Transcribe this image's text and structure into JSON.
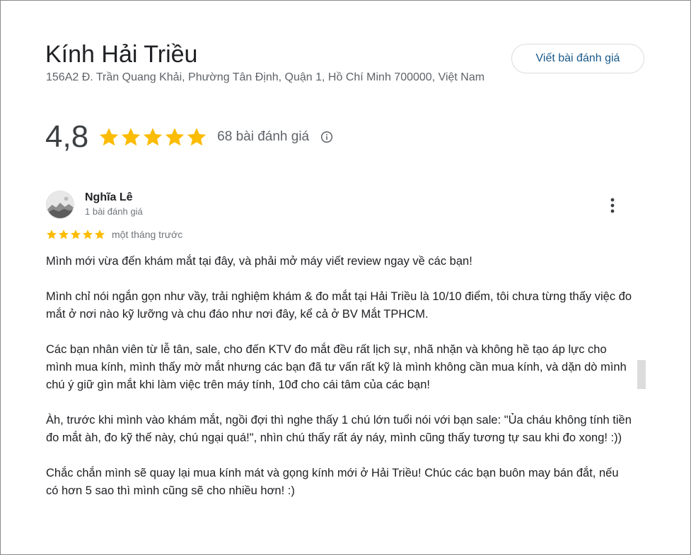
{
  "place": {
    "title": "Kính Hải Triều",
    "address": "156A2 Đ. Trần Quang Khải, Phường Tân Định, Quận 1, Hồ Chí Minh 700000, Việt Nam",
    "write_review_label": "Viết bài đánh giá",
    "rating": "4,8",
    "stars": 5,
    "review_count": "68 bài đánh giá"
  },
  "review": {
    "reviewer_name": "Nghĩa Lê",
    "reviewer_meta": "1 bài đánh giá",
    "stars": 5,
    "date": "một tháng trước",
    "paragraphs": [
      "Mình mới vừa đến khám mắt tại đây, và phải mở máy viết review ngay về các bạn!",
      "Mình chỉ nói ngắn gọn như vầy, trải nghiệm khám & đo mắt tại Hải Triều là 10/10 điểm, tôi chưa từng thấy việc đo mắt ở nơi nào kỹ lưỡng và chu đáo như nơi đây, kể cả ở BV Mắt TPHCM.",
      "Các bạn nhân viên từ lễ tân, sale, cho đến KTV đo mắt đều rất lịch sự, nhã nhặn và không hề tạo áp lực cho mình mua kính, mình thấy mờ mắt nhưng các bạn đã tư vấn rất kỹ là mình không cần mua kính, và dặn dò mình chú ý giữ gìn mắt khi làm việc trên máy tính, 10đ cho cái tâm của các bạn!",
      "Àh, trước khi mình vào khám mắt, ngồi đợi thì nghe thấy 1 chú lớn tuổi nói với bạn sale: \"Ủa cháu không tính tiền đo mắt àh, đo kỹ thế này, chú ngại quá!\", nhìn chú thấy rất áy náy, mình cũng thấy tương tự sau khi đo xong! :))",
      "Chắc chắn mình sẽ quay lại mua kính mát và gọng kính mới ở Hải Triều! Chúc các bạn buôn may bán đắt, nếu có hơn 5 sao thì mình cũng sẽ cho nhiều hơn! :)"
    ]
  },
  "icons": {
    "star": "star-icon",
    "info": "info-icon",
    "more": "more-vert-icon"
  },
  "colors": {
    "star": "#fbbc04",
    "accent_text": "#1a5a8a",
    "secondary_text": "#5f6368"
  }
}
